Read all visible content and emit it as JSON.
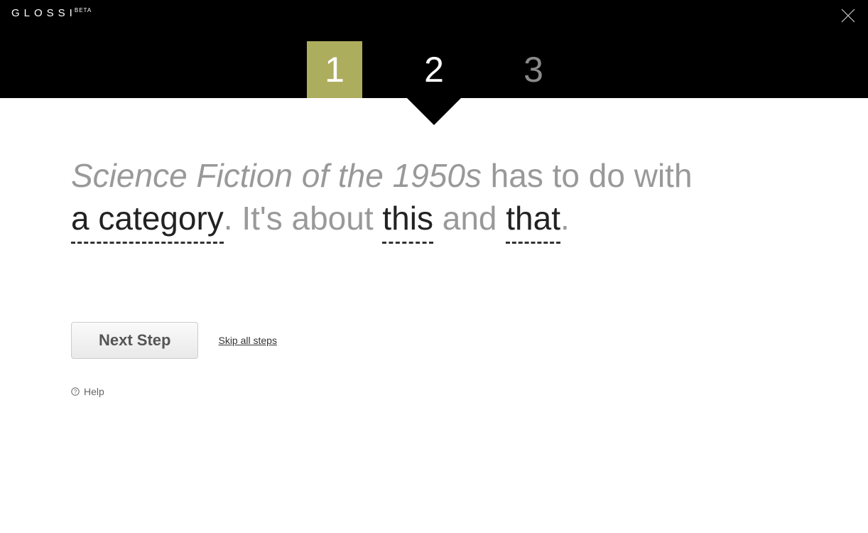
{
  "logo": {
    "text": "GLOSSI",
    "badge": "BETA"
  },
  "steps": {
    "step1": "1",
    "step2": "2",
    "step3": "3"
  },
  "madlib": {
    "title": "Science Fiction of the 1950s",
    "text1": " has to do with ",
    "blank1": "a category",
    "text2": ". It's about ",
    "blank2": "this",
    "text3": " and ",
    "blank3": "that",
    "text4": "."
  },
  "actions": {
    "next": "Next Step",
    "skip": "Skip all steps"
  },
  "help": {
    "label": "Help"
  }
}
